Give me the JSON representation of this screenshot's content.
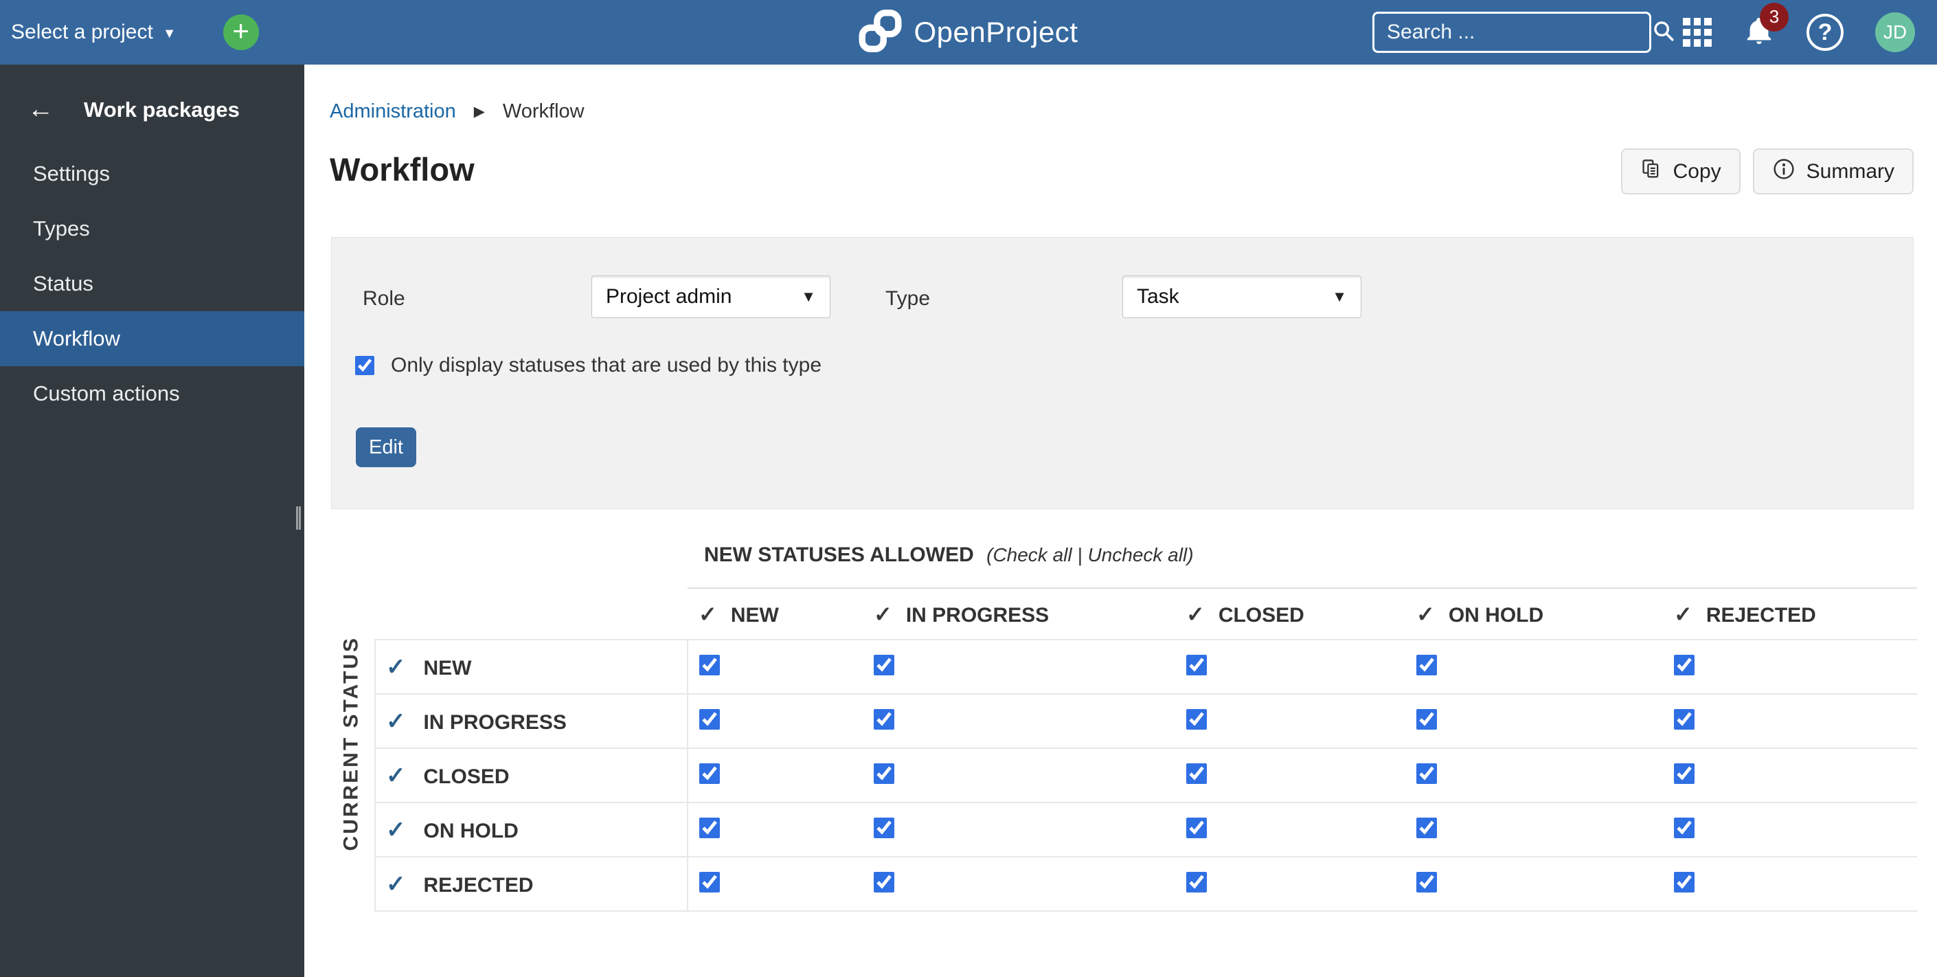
{
  "topbar": {
    "project_selector": "Select a project",
    "logo_text": "OpenProject",
    "search_placeholder": "Search ...",
    "notification_count": "3",
    "avatar_initials": "JD"
  },
  "icons": {
    "check": "✓",
    "back_arrow": "←",
    "caret_down": "▼",
    "breadcrumb_separator": "▶",
    "plus": "+",
    "help": "?"
  },
  "sidebar": {
    "title": "Work packages",
    "items": [
      {
        "label": "Settings",
        "active": false
      },
      {
        "label": "Types",
        "active": false
      },
      {
        "label": "Status",
        "active": false
      },
      {
        "label": "Workflow",
        "active": true
      },
      {
        "label": "Custom actions",
        "active": false
      }
    ]
  },
  "breadcrumb": {
    "items": [
      {
        "label": "Administration"
      },
      {
        "label": "Workflow"
      }
    ]
  },
  "page": {
    "title": "Workflow"
  },
  "toolbar": {
    "copy_label": "Copy",
    "summary_label": "Summary"
  },
  "filter_panel": {
    "role_label": "Role",
    "role_value": "Project admin",
    "type_label": "Type",
    "type_value": "Task",
    "only_display_label": "Only display statuses that are used by this type",
    "only_display_checked": true,
    "edit_label": "Edit"
  },
  "workflow_table": {
    "caption": "NEW STATUSES ALLOWED",
    "caption_paren_open": "(",
    "check_all_label": "Check all",
    "caption_divider": " | ",
    "uncheck_all_label": "Uncheck all",
    "caption_paren_close": ")",
    "row_axis_label": "CURRENT STATUS",
    "columns": [
      "NEW",
      "IN PROGRESS",
      "CLOSED",
      "ON HOLD",
      "REJECTED"
    ],
    "rows": [
      "NEW",
      "IN PROGRESS",
      "CLOSED",
      "ON HOLD",
      "REJECTED"
    ],
    "matrix": [
      [
        true,
        true,
        true,
        true,
        true
      ],
      [
        true,
        true,
        true,
        true,
        true
      ],
      [
        true,
        true,
        true,
        true,
        true
      ],
      [
        true,
        true,
        true,
        true,
        true
      ],
      [
        true,
        true,
        true,
        true,
        true
      ]
    ]
  },
  "colors": {
    "header_blue": "#36689E",
    "active_item_blue": "#2D5E92",
    "checkbox_accent": "#2F6FE4",
    "row_check_blue": "#2C5F8A",
    "link_blue": "#1B67A4",
    "avatar_green": "#6AC1A0",
    "plus_green": "#4CB456",
    "badge_red": "#8C1A1D"
  }
}
